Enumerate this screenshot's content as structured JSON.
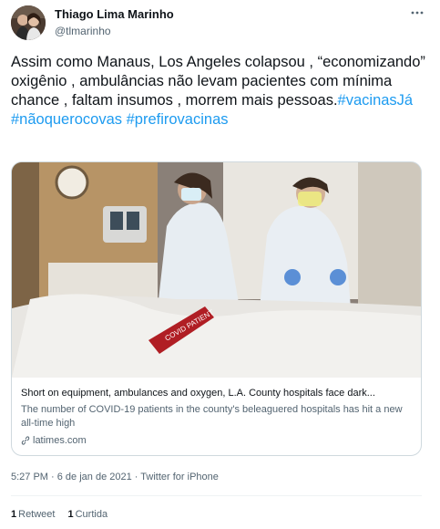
{
  "author": {
    "display_name": "Thiago Lima Marinho",
    "handle": "@tlmarinho",
    "avatar_icon": "profile-photo"
  },
  "more_icon": "more-horizontal-icon",
  "tweet": {
    "text": "Assim como Manaus, Los Angeles colapsou , “economizando” oxigênio , ambulâncias não levam pacientes com mínima chance , faltam insumos , morrem mais pessoas.",
    "hashtags": [
      "#vacinasJá",
      "#nãoquerocovas",
      "#prefirovacinas"
    ]
  },
  "card": {
    "title": "Short on equipment, ambulances and oxygen, L.A. County hospitals face dark...",
    "description": "The number of COVID-19 patients in the county's beleaguered hospitals has hit a new all-time high",
    "domain": "latimes.com",
    "image_label": "COVID PATIENT"
  },
  "meta": {
    "time": "5:27 PM",
    "separator": " · ",
    "date": "6 de jan de 2021",
    "source": "Twitter for iPhone"
  },
  "stats": {
    "retweets_count": "1",
    "retweets_label": "Retweet",
    "likes_count": "1",
    "likes_label": "Curtida"
  },
  "colors": {
    "link": "#1d9bf0",
    "text": "#0f1419",
    "secondary": "#536471",
    "border": "#cfd9de"
  }
}
